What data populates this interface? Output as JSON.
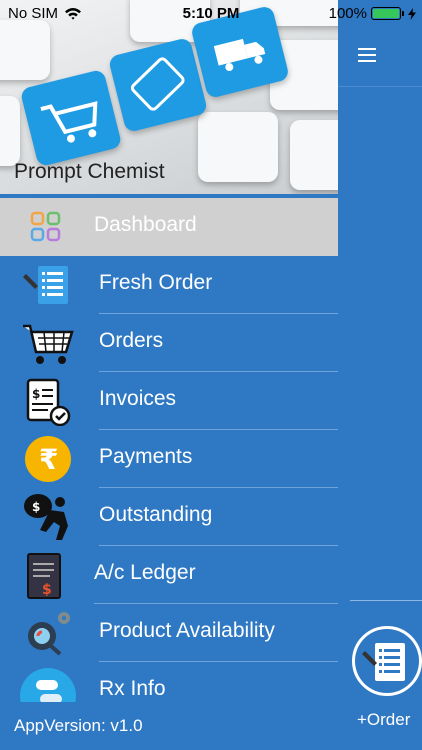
{
  "status": {
    "carrier": "No SIM",
    "time": "5:10 PM",
    "battery": "100%"
  },
  "header": {
    "brand": "Prompt Chemist"
  },
  "menu": [
    {
      "label": "Dashboard",
      "icon": "dashboard-grid-icon",
      "active": true
    },
    {
      "label": "Fresh Order",
      "icon": "fresh-order-icon"
    },
    {
      "label": "Orders",
      "icon": "cart-icon"
    },
    {
      "label": "Invoices",
      "icon": "invoice-icon"
    },
    {
      "label": "Payments",
      "icon": "rupee-icon"
    },
    {
      "label": "Outstanding",
      "icon": "outstanding-bag-icon"
    },
    {
      "label": "A/c Ledger",
      "icon": "ledger-icon"
    },
    {
      "label": "Product Availability",
      "icon": "gear-search-icon"
    },
    {
      "label": "Rx Info",
      "icon": "rx-pill-icon"
    }
  ],
  "footer": {
    "version": "AppVersion: v1.0"
  },
  "main": {
    "order_label": "+Order"
  },
  "colors": {
    "primary": "#2f78c4",
    "active_item": "#d0d0d0"
  }
}
